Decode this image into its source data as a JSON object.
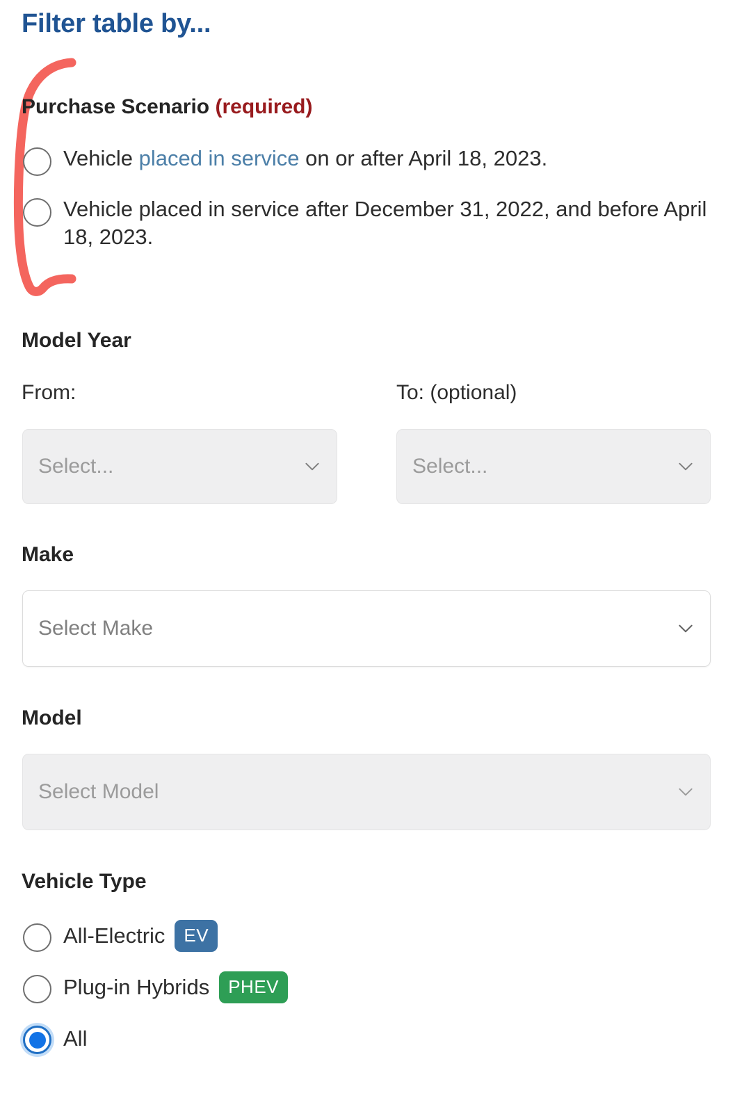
{
  "header": {
    "title": "Filter table by..."
  },
  "annotation": {
    "shape": "hand-drawn-bracket",
    "color": "#f4655e"
  },
  "purchase_scenario": {
    "heading": "Purchase Scenario",
    "required_flag": "(required)",
    "required_color": "#981b1e",
    "options": [
      {
        "id": "scenario-after-april-18-2023",
        "text_before": "Vehicle ",
        "link_text": "placed in service",
        "text_after": " on or after April 18, 2023.",
        "selected": false
      },
      {
        "id": "scenario-between-dec-31-2022-and-april-18-2023",
        "text_before": "Vehicle placed in service after December 31, 2022, and before April 18, 2023.",
        "link_text": "",
        "text_after": "",
        "selected": false
      }
    ]
  },
  "model_year": {
    "heading": "Model Year",
    "from": {
      "label": "From:",
      "value": "Select...",
      "disabled": true
    },
    "to": {
      "label": "To: (optional)",
      "value": "Select...",
      "disabled": true
    }
  },
  "make": {
    "heading": "Make",
    "value": "Select Make",
    "disabled": false
  },
  "model": {
    "heading": "Model",
    "value": "Select Model",
    "disabled": true
  },
  "vehicle_type": {
    "heading": "Vehicle Type",
    "options": [
      {
        "id": "all-electric",
        "label": "All-Electric",
        "badge": "EV",
        "badge_color": "#3d72a4",
        "selected": false
      },
      {
        "id": "plug-in-hybrids",
        "label": "Plug-in Hybrids",
        "badge": "PHEV",
        "badge_color": "#2e9e55",
        "selected": false
      },
      {
        "id": "all",
        "label": "All",
        "badge": "",
        "badge_color": "",
        "selected": true
      }
    ]
  },
  "colors": {
    "title_blue": "#205493",
    "link_blue": "#4c7fa8",
    "required_red": "#981b1e",
    "annotation_red": "#f4655e",
    "radio_selected_blue": "#1273e6"
  }
}
